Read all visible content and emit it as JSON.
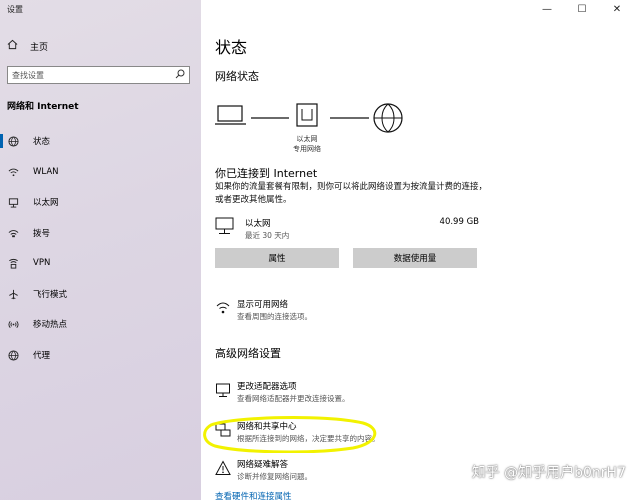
{
  "window": {
    "title": "设置",
    "minimize_glyph": "—",
    "maximize_glyph": "☐",
    "close_glyph": "✕"
  },
  "sidebar": {
    "home_label": "主页",
    "search_placeholder": "查找设置",
    "section_title": "网络和 Internet",
    "items": [
      {
        "label": "状态",
        "icon": "home-status-icon"
      },
      {
        "label": "WLAN",
        "icon": "wifi-icon"
      },
      {
        "label": "以太网",
        "icon": "ethernet-icon"
      },
      {
        "label": "拨号",
        "icon": "dialup-icon"
      },
      {
        "label": "VPN",
        "icon": "vpn-icon"
      },
      {
        "label": "飞行模式",
        "icon": "airplane-icon"
      },
      {
        "label": "移动热点",
        "icon": "hotspot-icon"
      },
      {
        "label": "代理",
        "icon": "globe-icon"
      }
    ]
  },
  "main": {
    "title": "状态",
    "network_status_heading": "网络状态",
    "diagram": {
      "adapter_label": "以太网",
      "network_label": "专用网络"
    },
    "connected_title": "你已连接到 Internet",
    "connected_desc": "如果你的流量套餐有限制，则你可以将此网络设置为按流量计费的连接，或者更改其他属性。",
    "ethernet": {
      "name": "以太网",
      "period": "最近 30 天内",
      "usage": "40.99 GB"
    },
    "buttons": {
      "properties": "属性",
      "data_usage": "数据使用量"
    },
    "show_networks": {
      "title": "显示可用网络",
      "desc": "查看周围的连接选项。"
    },
    "advanced_heading": "高级网络设置",
    "adapter_options": {
      "title": "更改适配器选项",
      "desc": "查看网络适配器并更改连接设置。"
    },
    "sharing_center": {
      "title": "网络和共享中心",
      "desc": "根据所连接到的网络，决定要共享的内容。"
    },
    "troubleshooter": {
      "title": "网络疑难解答",
      "desc": "诊断并修复网络问题。"
    },
    "hardware_link": "查看硬件和连接属性"
  },
  "overlay": {
    "watermark": "知乎 @知乎用户b0nrH7",
    "highlight_color": "#f2f200"
  }
}
